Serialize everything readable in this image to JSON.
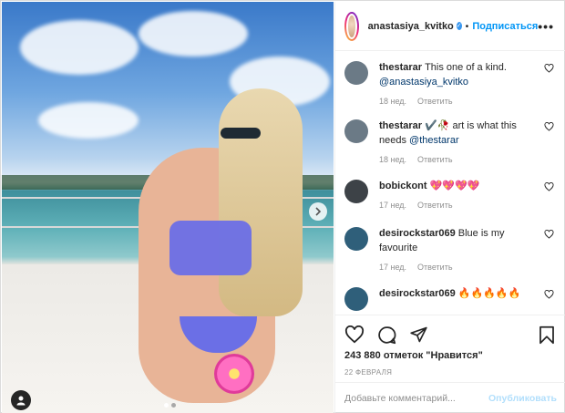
{
  "header": {
    "username": "anastasiya_kvitko",
    "dot": "•",
    "follow_label": "Подписаться",
    "more_label": "•••"
  },
  "comments": [
    {
      "user": "thestarar",
      "text": "This one of a kind.",
      "mention": "@anastasiya_kvitko",
      "time": "18 нед.",
      "reply": "Ответить",
      "avatar_color": "#6b7a86"
    },
    {
      "user": "thestarar",
      "text": "✔️🥀 art is what this needs",
      "mention": "@thestarar",
      "time": "18 нед.",
      "reply": "Ответить",
      "avatar_color": "#6b7a86"
    },
    {
      "user": "bobickont",
      "text": "💖💖💖💖",
      "mention": "",
      "time": "17 нед.",
      "reply": "Ответить",
      "avatar_color": "#3d4247"
    },
    {
      "user": "desirockstar069",
      "text": "Blue is my favourite",
      "mention": "",
      "time": "17 нед.",
      "reply": "Ответить",
      "avatar_color": "#2f5f7a"
    },
    {
      "user": "desirockstar069",
      "text": "🔥🔥🔥🔥🔥",
      "mention": "",
      "time": "",
      "reply": "",
      "avatar_color": "#2f5f7a"
    }
  ],
  "actions": {
    "like_icon": "heart-icon",
    "comment_icon": "comment-icon",
    "share_icon": "share-icon",
    "save_icon": "bookmark-icon"
  },
  "likes": "243 880 отметок \"Нравится\"",
  "date": "22 ФЕВРАЛЯ",
  "add_comment": {
    "placeholder": "Добавьте комментарий...",
    "publish_label": "Опубликовать"
  },
  "colors": {
    "accent": "#0095f6",
    "publish_disabled": "#b2dffc",
    "mention": "#00376b",
    "meta": "#8e8e8e"
  }
}
